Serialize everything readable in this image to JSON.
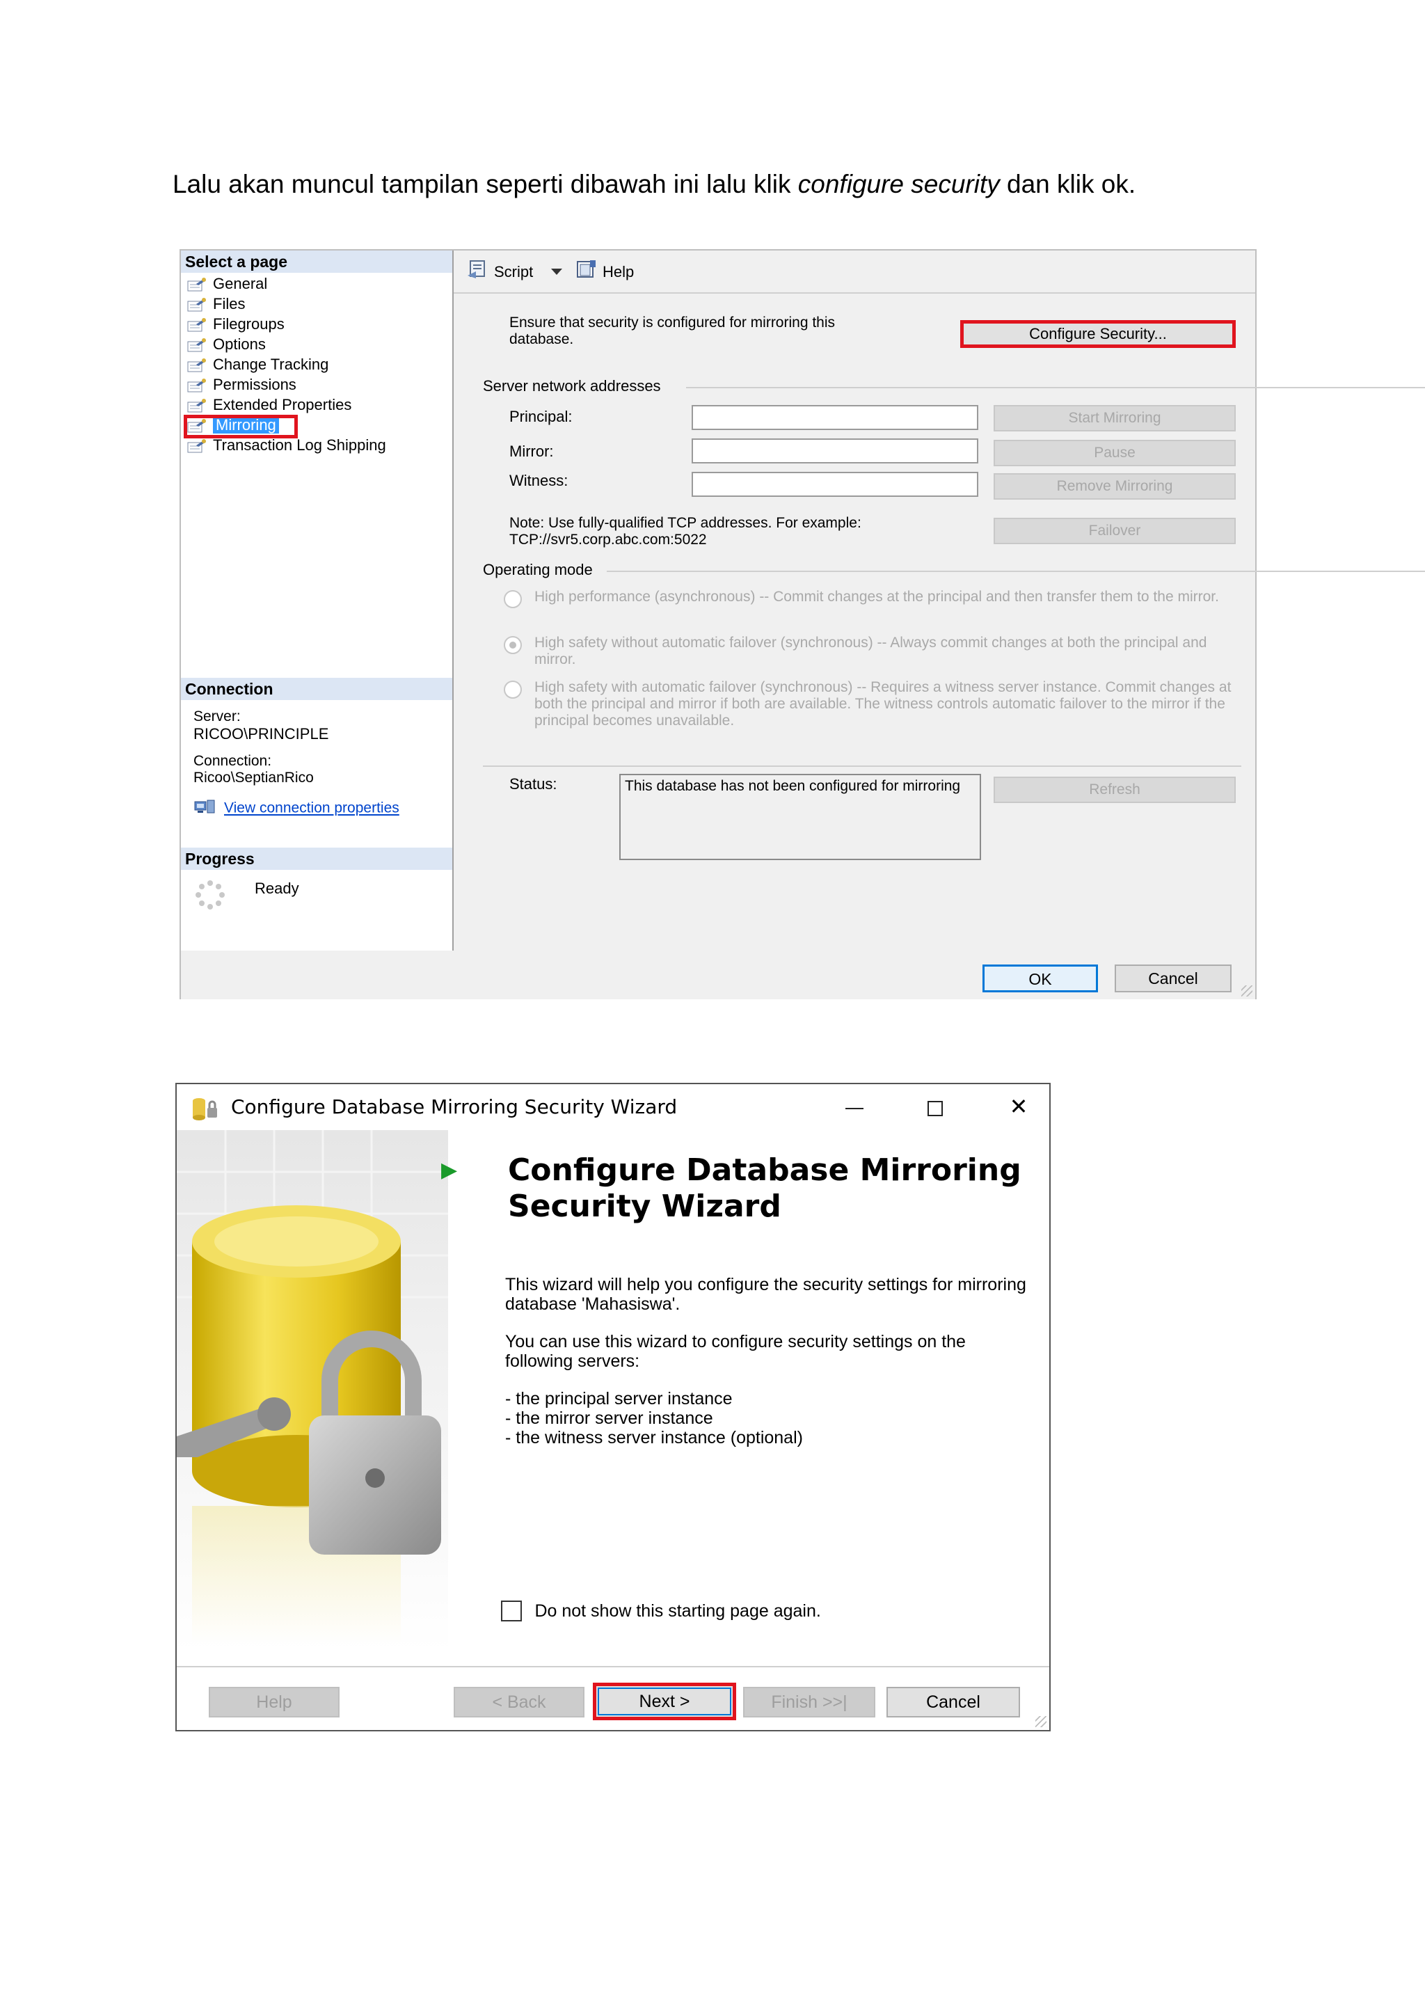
{
  "caption": {
    "before": "Lalu akan muncul tampilan seperti dibawah ini lalu klik ",
    "emphasis": "configure security",
    "after": " dan klik ok."
  },
  "properties_dialog": {
    "select_page_header": "Select a page",
    "pages": [
      "General",
      "Files",
      "Filegroups",
      "Options",
      "Change Tracking",
      "Permissions",
      "Extended Properties",
      "Mirroring",
      "Transaction Log Shipping"
    ],
    "selected_page": "Mirroring",
    "connection_header": "Connection",
    "server_label": "Server:",
    "server_value": "RICOO\\PRINCIPLE",
    "connection_label": "Connection:",
    "connection_value": "Ricoo\\SeptianRico",
    "view_connection_link": "View connection properties",
    "progress_header": "Progress",
    "progress_status": "Ready",
    "toolbar": {
      "script": "Script",
      "help": "Help"
    },
    "ensure_text": "Ensure that security is configured for mirroring this database.",
    "configure_security_button": "Configure Security...",
    "server_network_group": "Server network addresses",
    "principal_label": "Principal:",
    "mirror_label": "Mirror:",
    "witness_label": "Witness:",
    "principal_value": "",
    "mirror_value": "",
    "witness_value": "",
    "start_mirroring_button": "Start Mirroring",
    "pause_button": "Pause",
    "remove_mirroring_button": "Remove Mirroring",
    "failover_button": "Failover",
    "note_text": "Note: Use fully-qualified TCP addresses. For example:",
    "note_example": "TCP://svr5.corp.abc.com:5022",
    "operating_mode_group": "Operating mode",
    "modes": [
      {
        "text": "High performance (asynchronous) -- Commit changes at the principal and then transfer them to the mirror.",
        "checked": false
      },
      {
        "text": "High safety without automatic failover (synchronous) -- Always commit changes at both the principal and mirror.",
        "checked": true
      },
      {
        "text": "High safety with automatic failover (synchronous) -- Requires a witness server instance. Commit changes at both the principal and mirror if both are available. The witness controls automatic failover to the mirror if the principal becomes unavailable.",
        "checked": false
      }
    ],
    "status_label": "Status:",
    "status_value": "This database has not been configured for mirroring",
    "refresh_button": "Refresh",
    "ok_button": "OK",
    "cancel_button": "Cancel"
  },
  "wizard": {
    "window_title": "Configure Database Mirroring Security Wizard",
    "heading": "Configure Database Mirroring Security Wizard",
    "intro": "This wizard will help you configure the security settings for mirroring database 'Mahasiswa'.",
    "servers_intro": "You can use this wizard to configure security settings on the following servers:",
    "servers": [
      "- the principal server instance",
      "- the mirror server instance",
      "- the witness server instance (optional)"
    ],
    "dont_show_label": "Do not show this starting page again.",
    "dont_show_checked": false,
    "help_button": "Help",
    "back_button": "< Back",
    "next_button": "Next >",
    "finish_button": "Finish >>|",
    "cancel_button": "Cancel"
  },
  "colors": {
    "highlight_red": "#e0141e",
    "selection_blue": "#3399ff",
    "link_blue": "#0044cc"
  }
}
